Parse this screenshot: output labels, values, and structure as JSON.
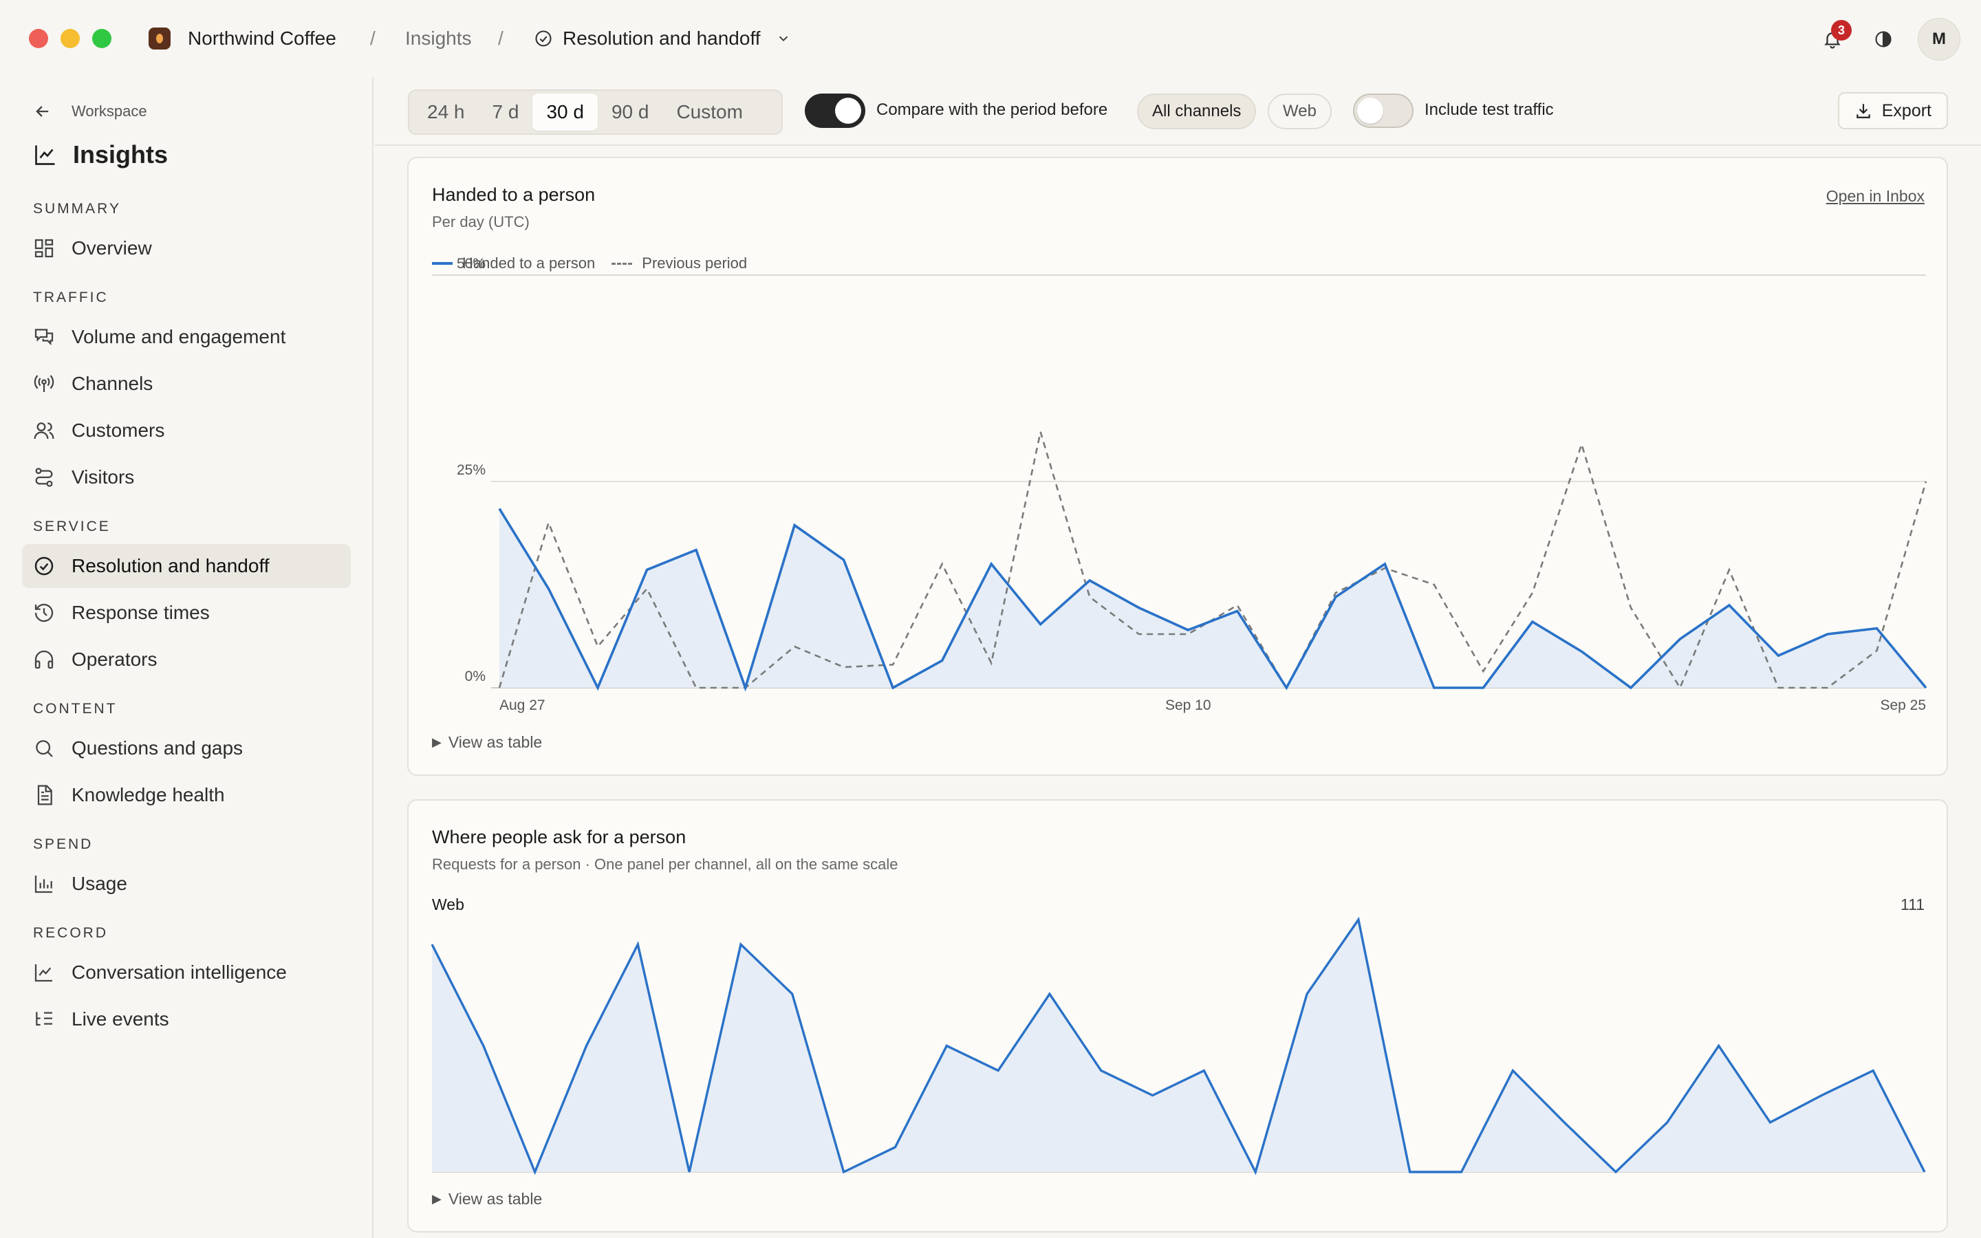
{
  "titlebar": {
    "brand": "Northwind Coffee",
    "separator": "/",
    "crumb_insights": "Insights",
    "crumb_current": "Resolution and handoff",
    "notification_count": "3",
    "avatar_initial": "M"
  },
  "sidebar": {
    "back_label": "Workspace",
    "title": "Insights",
    "sections": {
      "summary": "SUMMARY",
      "traffic": "TRAFFIC",
      "service": "SERVICE",
      "content": "CONTENT",
      "spend": "SPEND",
      "record": "RECORD"
    },
    "items": {
      "overview": "Overview",
      "volume": "Volume and engagement",
      "channels": "Channels",
      "customers": "Customers",
      "visitors": "Visitors",
      "resolution": "Resolution and handoff",
      "response": "Response times",
      "operators": "Operators",
      "questions": "Questions and gaps",
      "knowledge": "Knowledge health",
      "usage": "Usage",
      "conversation": "Conversation intelligence",
      "live": "Live events"
    }
  },
  "toolbar": {
    "ranges": [
      "24 h",
      "7 d",
      "30 d",
      "90 d",
      "Custom"
    ],
    "active_range": "30 d",
    "compare_label": "Compare with the period before",
    "compare_on": true,
    "channel_all": "All channels",
    "channel_web": "Web",
    "test_traffic_label": "Include test traffic",
    "test_traffic_on": false,
    "export_label": "Export"
  },
  "card1": {
    "title": "Handed to a person",
    "subtitle": "Per day (UTC)",
    "link": "Open in Inbox",
    "legend_current": "Handed to a person",
    "legend_previous": "Previous period",
    "view_table": "View as table"
  },
  "card2": {
    "title": "Where people ask for a person",
    "subtitle": "Requests for a person · One panel per channel, all on the same scale",
    "panel_label": "Web",
    "panel_max": "111",
    "view_table": "View as table"
  },
  "colors": {
    "accent": "#2a72c8",
    "area_fill": "#e6edf6",
    "previous": "#7a7a7a"
  },
  "chart_data": [
    {
      "type": "area",
      "title": "Handed to a person",
      "subtitle": "Per day (UTC)",
      "y_ticks": [
        "0%",
        "25%",
        "50%"
      ],
      "ylim": [
        0,
        50
      ],
      "x_tick_labels": [
        "Aug 27",
        "Sep 10",
        "Sep 25"
      ],
      "x_tick_index": [
        0,
        14,
        29
      ],
      "series": [
        {
          "name": "Handed to a person",
          "style": "solid",
          "values": [
            21.7,
            12,
            0,
            14.3,
            16.7,
            0,
            19.7,
            15.5,
            0,
            3.3,
            15,
            7.7,
            13,
            9.7,
            7,
            9.3,
            0,
            11,
            15,
            0,
            0,
            8,
            4.4,
            0,
            5.9,
            10,
            3.9,
            6.5,
            7.2,
            0
          ]
        },
        {
          "name": "Previous period",
          "style": "dashed",
          "values": [
            0,
            20,
            5,
            12,
            0,
            0,
            5,
            2.5,
            2.8,
            15,
            3,
            31,
            11,
            6.5,
            6.5,
            10,
            0,
            11.5,
            14.5,
            12.5,
            2,
            11.5,
            29.5,
            9.7,
            0,
            14.3,
            0,
            0,
            4.5,
            25
          ]
        }
      ]
    },
    {
      "type": "area",
      "title": "Where people ask for a person",
      "panels": [
        {
          "name": "Web",
          "ymax": 111,
          "values": [
            101,
            56,
            0,
            56,
            101,
            0,
            101,
            79,
            0,
            11,
            56,
            45,
            79,
            45,
            34,
            45,
            0,
            79,
            112,
            0,
            0,
            45,
            22,
            0,
            22,
            56,
            22,
            34,
            45,
            0
          ]
        }
      ]
    }
  ]
}
